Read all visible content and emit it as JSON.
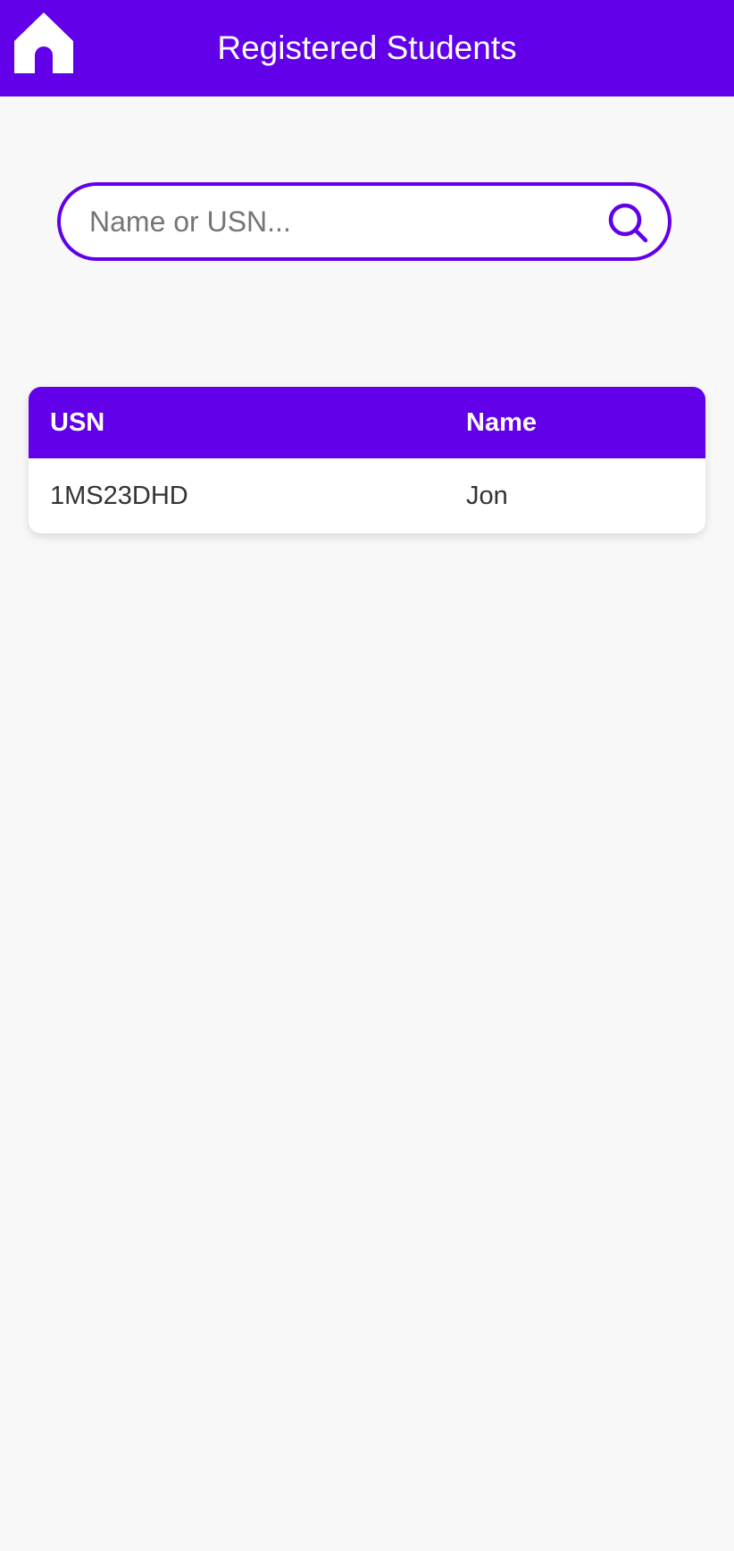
{
  "colors": {
    "primary": "#6200ea",
    "background": "#f8f8f8",
    "card": "#ffffff",
    "text": "#333333"
  },
  "header": {
    "title": "Registered Students",
    "home_icon": "home-icon"
  },
  "search": {
    "placeholder": "Name or USN...",
    "value": "",
    "icon": "search-icon"
  },
  "table": {
    "columns": [
      "USN",
      "Name"
    ],
    "rows": [
      {
        "usn": "1MS23DHD",
        "name": "Jon"
      }
    ]
  }
}
